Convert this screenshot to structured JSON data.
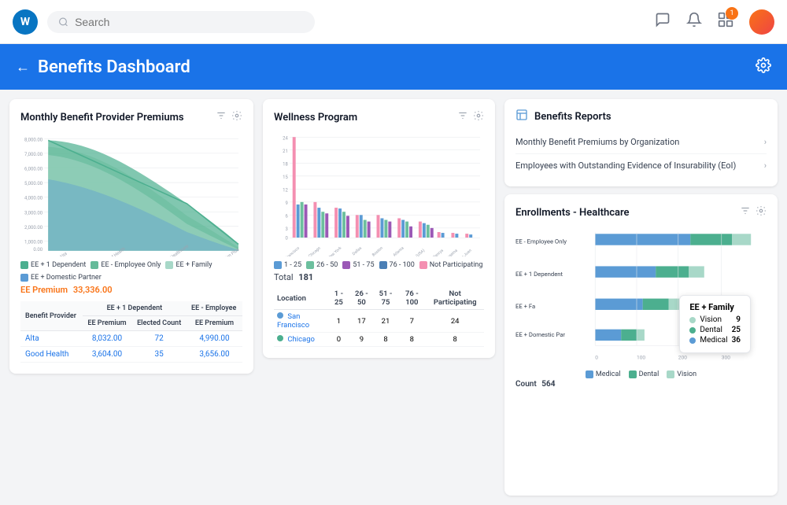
{
  "nav": {
    "logo": "W",
    "search_placeholder": "Search",
    "badge_count": "1",
    "icons": [
      "chat",
      "bell",
      "apps"
    ]
  },
  "header": {
    "title": "Benefits Dashboard",
    "back_label": "←"
  },
  "monthly_premiums": {
    "title": "Monthly Benefit Provider Premiums",
    "ee_premium_label": "EE Premium",
    "ee_premium_value": "33,336.00",
    "legend": [
      {
        "label": "EE + 1 Dependent",
        "color": "#4caf8f"
      },
      {
        "label": "EE - Employee Only",
        "color": "#66bb9a"
      },
      {
        "label": "EE + Family",
        "color": "#a8d8c8"
      },
      {
        "label": "EE + Domestic Partner",
        "color": "#5b9bd5"
      }
    ],
    "y_axis": [
      "8,000.00",
      "7,000.00",
      "6,000.00",
      "5,000.00",
      "4,000.00",
      "3,000.00",
      "2,000.00",
      "1,000.00",
      "0.00"
    ],
    "x_axis": [
      "Alta",
      "Good Health",
      "UnitedHealthcare",
      "Vision Plus"
    ],
    "table": {
      "col_groups": [
        "EE + 1 Dependent",
        "EE - Employee"
      ],
      "cols": [
        "Benefit Provider",
        "EE Premium",
        "Elected Count",
        "EE Premium"
      ],
      "rows": [
        {
          "provider": "Alta",
          "premium1": "8,032.00",
          "count": "72",
          "premium2": "4,990.00"
        },
        {
          "provider": "Good Health",
          "premium1": "3,604.00",
          "count": "35",
          "premium2": "3,656.00"
        }
      ]
    }
  },
  "wellness": {
    "title": "Wellness Program",
    "total_label": "Total",
    "total_value": "181",
    "legend": [
      {
        "label": "1 - 25",
        "color": "#5b9bd5"
      },
      {
        "label": "26 - 50",
        "color": "#6cbf9e"
      },
      {
        "label": "51 - 75",
        "color": "#9b59b6"
      },
      {
        "label": "76 - 100",
        "color": "#4a7fb5"
      },
      {
        "label": "Not Participating",
        "color": "#f48fb1"
      }
    ],
    "x_axis": [
      "San Francisco",
      "Chicago",
      "New York",
      "Dallas",
      "Boston",
      "Atlanta",
      "Home Office (USA)",
      "Benrys",
      "Hagatna",
      "San Juan"
    ],
    "y_axis": [
      "24",
      "21",
      "18",
      "15",
      "12",
      "9",
      "6",
      "3",
      "0"
    ],
    "table": {
      "cols": [
        "Location",
        "1 - 25",
        "26 - 50",
        "51 - 75",
        "76 - 100",
        "Not Participating"
      ],
      "rows": [
        {
          "location": "San Francisco",
          "color": "#5b9bd5",
          "v1": "1",
          "v2": "17",
          "v3": "21",
          "v4": "7",
          "v5": "24"
        },
        {
          "location": "Chicago",
          "color": "#4caf8f",
          "v1": "0",
          "v2": "9",
          "v3": "8",
          "v4": "8",
          "v5": "8"
        }
      ]
    }
  },
  "benefits_reports": {
    "title": "Benefits Reports",
    "icon": "📋",
    "items": [
      {
        "label": "Monthly Benefit Premiums by Organization"
      },
      {
        "label": "Employees with Outstanding Evidence of Insurability (EoI)"
      }
    ]
  },
  "enrollments": {
    "title": "Enrollments - Healthcare",
    "count_label": "Count",
    "count_value": "564",
    "categories": [
      "EE - Employee Only",
      "EE + 1 Dependent",
      "EE + Fa",
      "EE + Domestic Par"
    ],
    "legend": [
      {
        "label": "Medical",
        "color": "#5b9bd5"
      },
      {
        "label": "Dental",
        "color": "#4caf8f"
      },
      {
        "label": "Vision",
        "color": "#a8d8c8"
      }
    ],
    "tooltip": {
      "title": "EE + Family",
      "rows": [
        {
          "label": "Vision",
          "value": 9,
          "color": "#a8d8c8"
        },
        {
          "label": "Dental",
          "value": 25,
          "color": "#4caf8f"
        },
        {
          "label": "Medical",
          "value": 36,
          "color": "#5b9bd5"
        }
      ]
    }
  }
}
